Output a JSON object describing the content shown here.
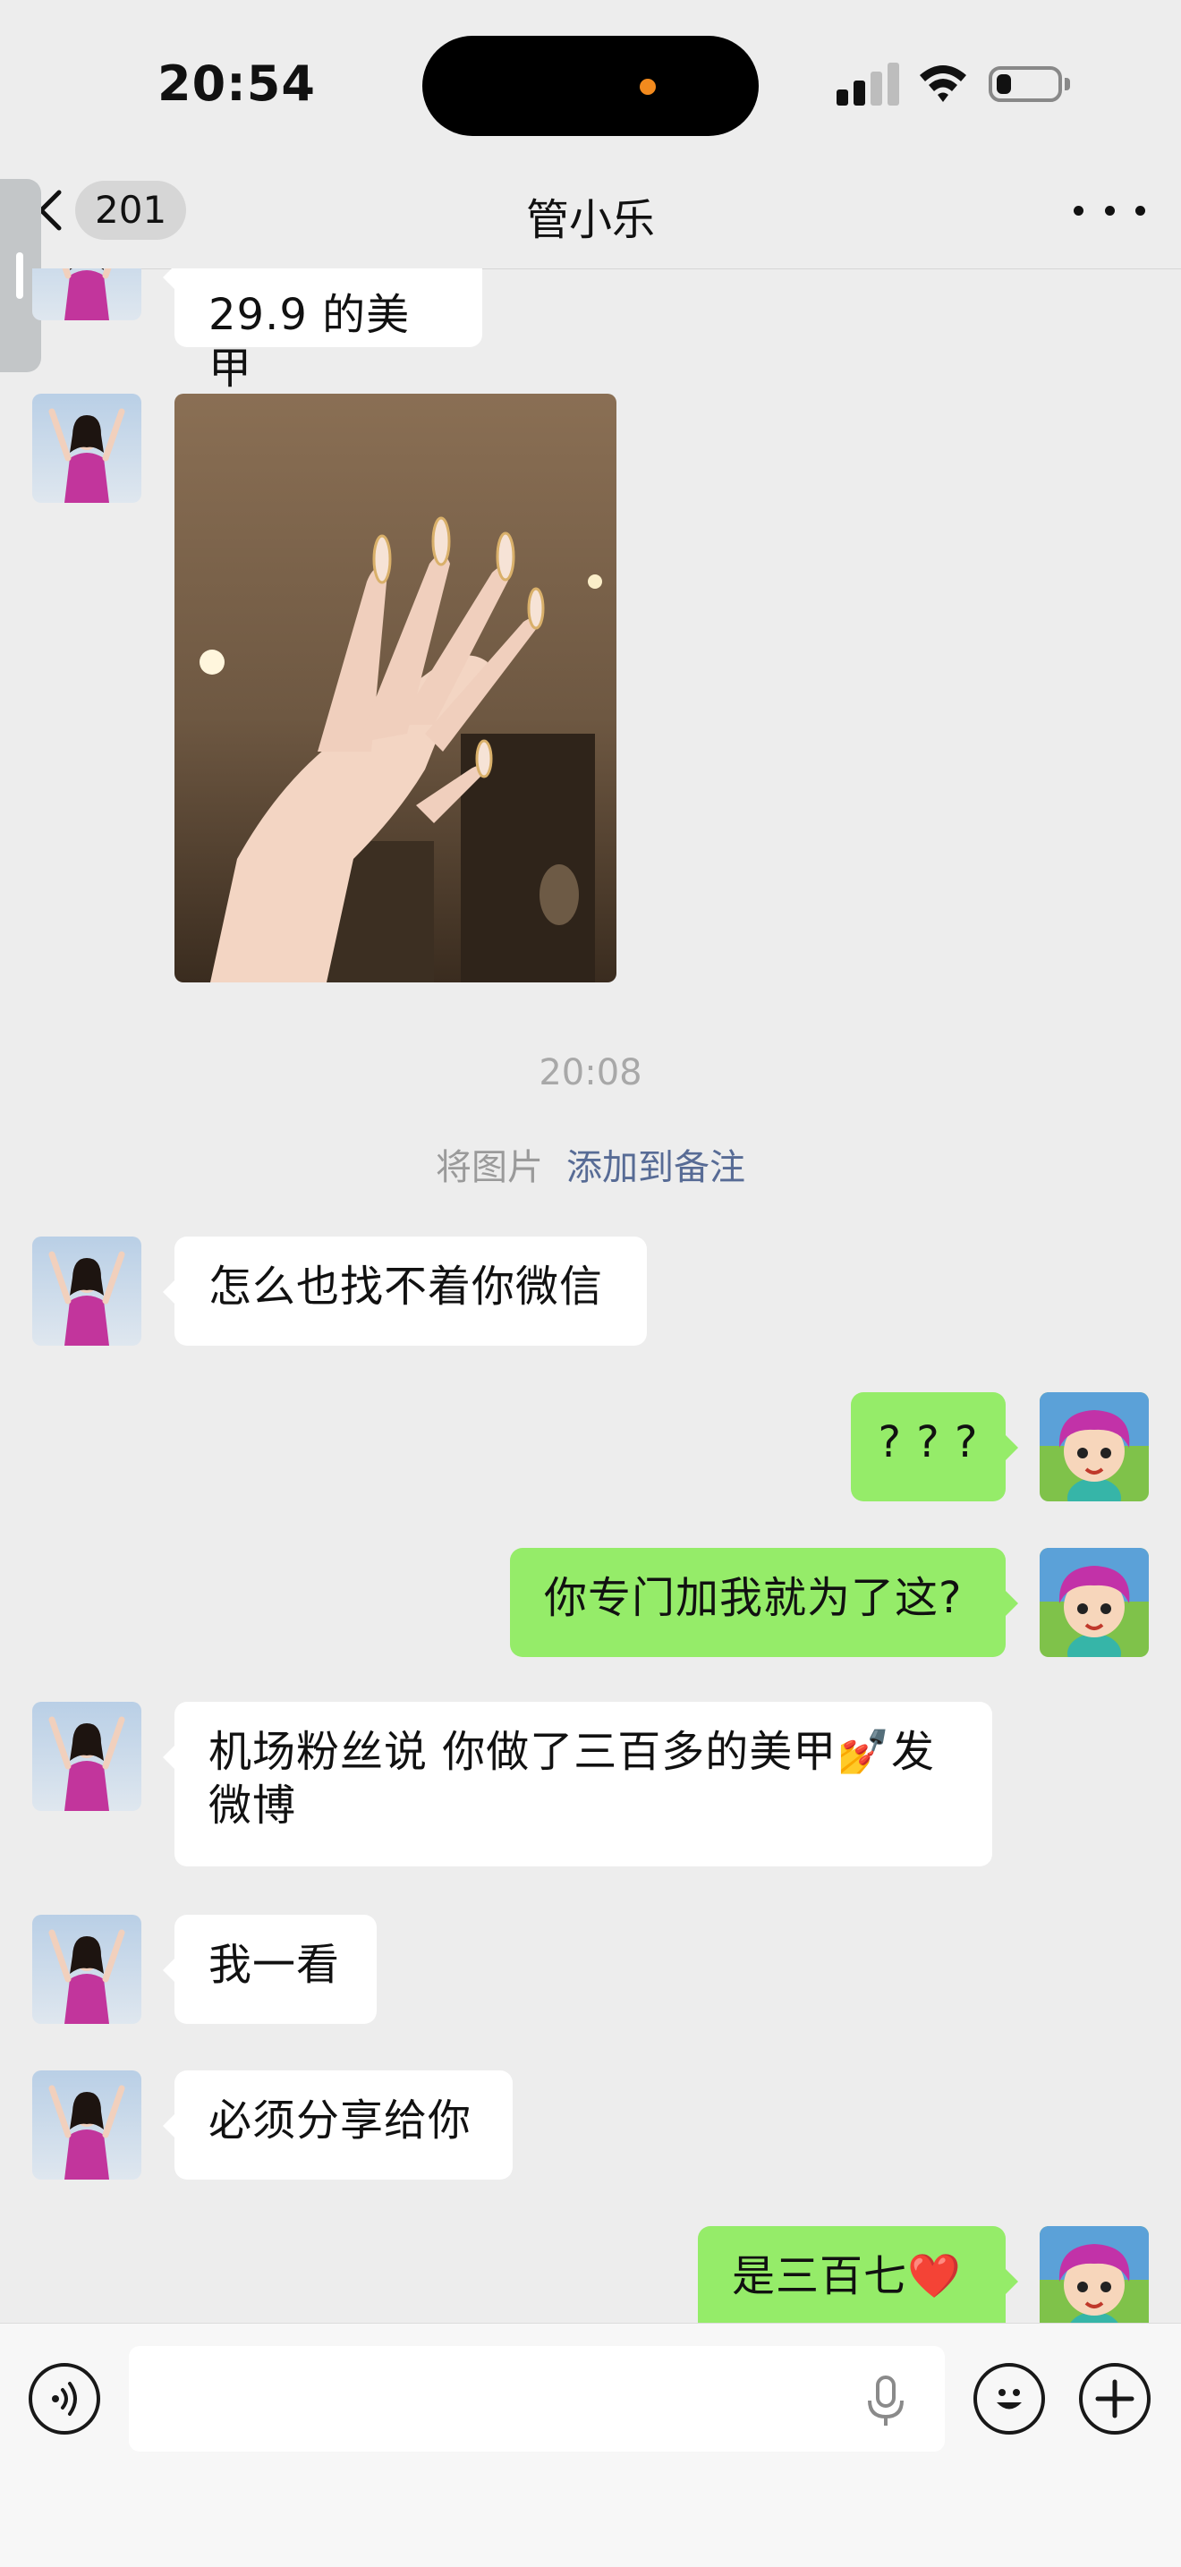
{
  "status_bar": {
    "time": "20:54",
    "signal_bars_active": 2,
    "signal_bars_total": 4,
    "battery_level": 0.25
  },
  "nav": {
    "back_label": "",
    "unread_count": "201",
    "title": "管小乐",
    "more_icon": "more-dots-icon"
  },
  "messages": [
    {
      "from": "other",
      "type": "text",
      "text": "29.9 的美甲"
    },
    {
      "from": "other",
      "type": "image",
      "alt": "nails-photo"
    },
    {
      "type": "timestamp",
      "text": "20:08"
    },
    {
      "type": "system",
      "prefix": "将图片",
      "link": "添加到备注"
    },
    {
      "from": "other",
      "type": "text",
      "text": "怎么也找不着你微信"
    },
    {
      "from": "me",
      "type": "text",
      "text": "? ? ?"
    },
    {
      "from": "me",
      "type": "text",
      "text": "你专门加我就为了这?"
    },
    {
      "from": "other",
      "type": "text",
      "line1": "机场粉丝说 你做了三百多的美甲💅发",
      "line2": "微博"
    },
    {
      "from": "other",
      "type": "text",
      "text": "我一看"
    },
    {
      "from": "other",
      "type": "text",
      "text": "必须分享给你"
    },
    {
      "from": "me",
      "type": "text",
      "text": "是三百七❤️"
    }
  ],
  "input_bar": {
    "voice_icon": "voice-mode-icon",
    "mic_icon": "microphone-icon",
    "emoji_icon": "emoji-icon",
    "plus_icon": "plus-icon",
    "placeholder": ""
  },
  "colors": {
    "background": "#ededed",
    "my_bubble": "#95ec69",
    "other_bubble": "#ffffff",
    "link": "#576b95"
  }
}
